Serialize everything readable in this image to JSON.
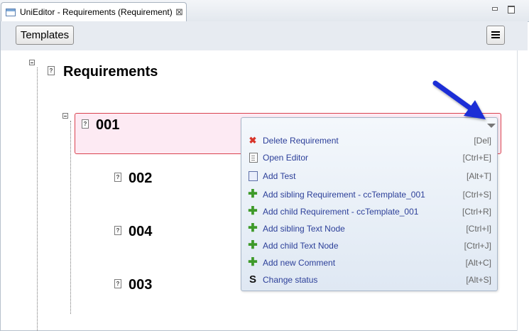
{
  "tab": {
    "title": "UniEditor - Requirements (Requirement)",
    "close_glyph": "⊠"
  },
  "toolbar": {
    "templates_label": "Templates",
    "menu_icon": "hamburger-menu-icon"
  },
  "tree": {
    "root": {
      "label": "Requirements",
      "icon": "requirement-node-icon",
      "icon_glyph": "?"
    },
    "nodes": [
      {
        "label": "001",
        "icon_glyph": "?",
        "selected": true
      },
      {
        "label": "002",
        "icon_glyph": "?"
      },
      {
        "label": "004",
        "icon_glyph": "?"
      },
      {
        "label": "003",
        "icon_glyph": "?"
      }
    ]
  },
  "context_menu": {
    "items": [
      {
        "label": "Delete Requirement",
        "shortcut": "[Del]",
        "icon": "delete-x-icon",
        "glyph": "✖"
      },
      {
        "label": "Open Editor",
        "shortcut": "[Ctrl+E]",
        "icon": "document-icon",
        "glyph": ""
      },
      {
        "label": "Add Test",
        "shortcut": "[Alt+T]",
        "icon": "test-icon",
        "glyph": ""
      },
      {
        "label": "Add sibling Requirement - ccTemplate_001",
        "shortcut": "[Ctrl+S]",
        "icon": "green-plus-icon",
        "glyph": "✚"
      },
      {
        "label": "Add child Requirement - ccTemplate_001",
        "shortcut": "[Ctrl+R]",
        "icon": "green-plus-icon",
        "glyph": "✚"
      },
      {
        "label": "Add sibling Text Node",
        "shortcut": "[Ctrl+I]",
        "icon": "green-plus-icon",
        "glyph": "✚"
      },
      {
        "label": "Add child Text Node",
        "shortcut": "[Ctrl+J]",
        "icon": "green-plus-icon",
        "glyph": "✚"
      },
      {
        "label": "Add new Comment",
        "shortcut": "[Alt+C]",
        "icon": "green-plus-icon",
        "glyph": "✚"
      },
      {
        "label": "Change status",
        "shortcut": "[Alt+S]",
        "icon": "status-icon",
        "glyph": "S"
      }
    ]
  },
  "colors": {
    "menu_text": "#2c3f99",
    "selected_border": "#d9424f",
    "selected_bg": "#fdeaf3",
    "pointer_arrow": "#1a2fd6"
  }
}
